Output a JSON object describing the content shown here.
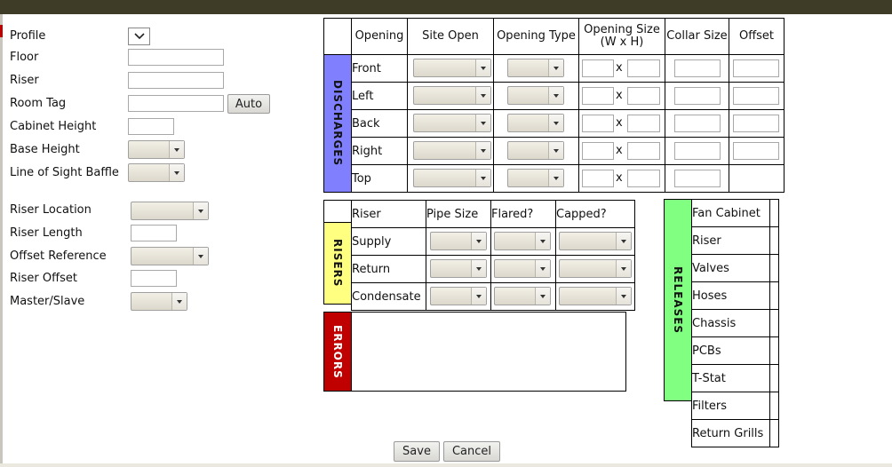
{
  "colors": {
    "top_bar": "#3e3b26",
    "discharges": "#8080ff",
    "risers": "#ffff80",
    "errors": "#c00000",
    "releases": "#80ff80"
  },
  "form": {
    "profile": "Profile",
    "floor": "Floor",
    "riser": "Riser",
    "room_tag": "Room Tag",
    "auto_button": "Auto",
    "cabinet_height": "Cabinet Height",
    "base_height": "Base Height",
    "line_of_sight_baffle": "Line of Sight Baffle",
    "riser_location": "Riser Location",
    "riser_length": "Riser Length",
    "offset_reference": "Offset Reference",
    "riser_offset": "Riser Offset",
    "master_slave": "Master/Slave"
  },
  "discharges": {
    "title": "DISCHARGES",
    "headers": {
      "opening": "Opening",
      "site_open": "Site Open",
      "opening_type": "Opening Type",
      "opening_size": "Opening Size (W x H)",
      "collar_size": "Collar Size",
      "offset": "Offset"
    },
    "rows": [
      "Front",
      "Left",
      "Back",
      "Right",
      "Top"
    ],
    "x": "x"
  },
  "risers": {
    "title": "RISERS",
    "headers": {
      "riser": "Riser",
      "pipe_size": "Pipe Size",
      "flared": "Flared?",
      "capped": "Capped?"
    },
    "rows": [
      "Supply",
      "Return",
      "Condensate"
    ]
  },
  "errors": {
    "title": "ERRORS"
  },
  "releases": {
    "title": "RELEASES",
    "items": [
      "Fan Cabinet",
      "Riser",
      "Valves",
      "Hoses",
      "Chassis",
      "PCBs",
      "T-Stat",
      "Filters",
      "Return Grills"
    ]
  },
  "footer": {
    "save": "Save",
    "cancel": "Cancel"
  }
}
